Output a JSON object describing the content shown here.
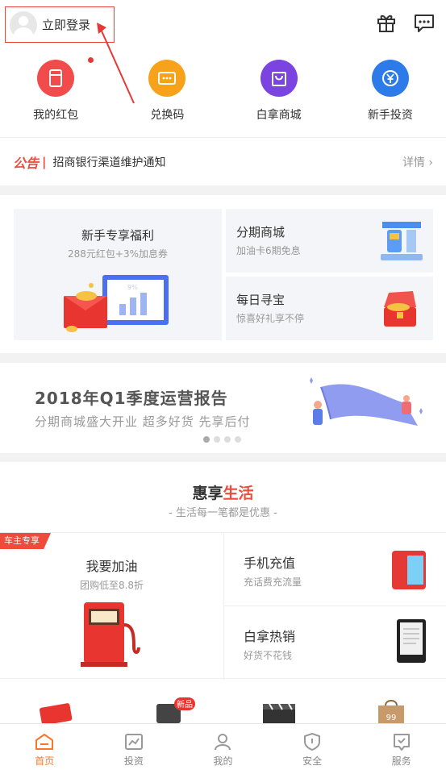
{
  "header": {
    "login_label": "立即登录"
  },
  "quick_links": [
    {
      "label": "我的红包",
      "icon": "red-packet-icon",
      "color": "#f24b4b"
    },
    {
      "label": "兑换码",
      "icon": "code-icon",
      "color": "#f7a21b"
    },
    {
      "label": "白拿商城",
      "icon": "shopping-bag-icon",
      "color": "#7b43df"
    },
    {
      "label": "新手投资",
      "icon": "yuan-icon",
      "color": "#2d7be8"
    }
  ],
  "notice": {
    "tag": "公告",
    "text": "招商银行渠道维护通知",
    "more": "详情"
  },
  "promo": {
    "newbie": {
      "title": "新手专享福利",
      "subtitle": "288元红包+3%加息券",
      "chart_label": "9%"
    },
    "installment": {
      "title": "分期商城",
      "subtitle": "加油卡6期免息"
    },
    "treasure": {
      "title": "每日寻宝",
      "subtitle": "惊喜好礼享不停"
    }
  },
  "banner": {
    "title": "2018年Q1季度运营报告",
    "subtitle": "分期商城盛大开业 超多好货 先享后付",
    "slide_count": 4,
    "active_slide": 1
  },
  "life": {
    "title_main": "惠享",
    "title_accent": "生活",
    "subtitle": "- 生活每一笔都是优惠 -",
    "fuel": {
      "tag": "车主专享",
      "title": "我要加油",
      "subtitle": "团购低至8.8折"
    },
    "recharge": {
      "title": "手机充值",
      "subtitle": "充话费充流量"
    },
    "hot": {
      "title": "白拿热销",
      "subtitle": "好货不花钱"
    },
    "new_badge": "新品",
    "bag_label": "99"
  },
  "tabs": [
    {
      "label": "首页",
      "icon": "home-icon",
      "active": true
    },
    {
      "label": "投资",
      "icon": "chart-icon",
      "active": false
    },
    {
      "label": "我的",
      "icon": "user-icon",
      "active": false
    },
    {
      "label": "安全",
      "icon": "shield-icon",
      "active": false
    },
    {
      "label": "服务",
      "icon": "service-icon",
      "active": false
    }
  ],
  "colors": {
    "accent": "#ef4b3b",
    "tab_active": "#f7762b"
  }
}
